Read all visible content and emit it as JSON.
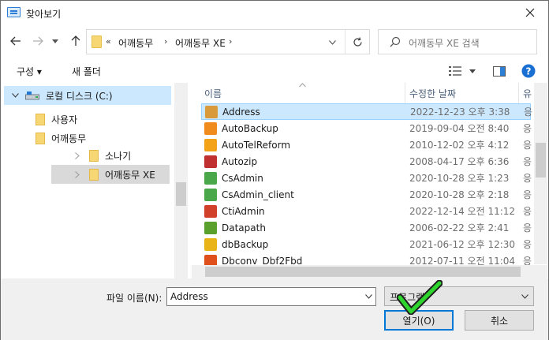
{
  "window": {
    "title": "찾아보기"
  },
  "address": {
    "overflow": "«",
    "crumbs": [
      "어깨동무",
      "어깨동무 XE"
    ]
  },
  "search": {
    "placeholder": "어깨동무 XE 검색"
  },
  "toolbar": {
    "organize": "구성 ▾",
    "new_folder": "새 폴더"
  },
  "tree": [
    {
      "label": "로컬 디스크 (C:)",
      "icon": "drive-icon"
    },
    {
      "label": "사용자",
      "icon": "folder-icon"
    },
    {
      "label": "어깨동무",
      "icon": "folder-icon"
    },
    {
      "label": "소나기",
      "icon": "folder-icon"
    },
    {
      "label": "어깨동무 XE",
      "icon": "folder-icon"
    }
  ],
  "columns": {
    "name": "이름",
    "date": "수정한 날짜",
    "type": "유"
  },
  "files": [
    {
      "name": "Address",
      "date": "2022-12-23 오후 3:38",
      "type": "응",
      "icon": "address-book-icon",
      "color": "#d99a3c"
    },
    {
      "name": "AutoBackup",
      "date": "2019-09-04 오전 8:40",
      "type": "응",
      "icon": "database-icon",
      "color": "#f08c1e"
    },
    {
      "name": "AutoTelReform",
      "date": "2010-12-02 오후 4:12",
      "type": "응",
      "icon": "telephone-icon",
      "color": "#f2a318"
    },
    {
      "name": "Autozip",
      "date": "2008-04-17 오후 6:36",
      "type": "응",
      "icon": "window-app-icon",
      "color": "#c03030"
    },
    {
      "name": "CsAdmin",
      "date": "2020-10-28 오후 1:23",
      "type": "응",
      "icon": "gear-icon",
      "color": "#4aa84a"
    },
    {
      "name": "CsAdmin_client",
      "date": "2020-10-28 오후 2:18",
      "type": "응",
      "icon": "gear-icon",
      "color": "#4aa84a"
    },
    {
      "name": "CtiAdmin",
      "date": "2022-12-14 오전 11:12",
      "type": "응",
      "icon": "phone-icon",
      "color": "#d0402a"
    },
    {
      "name": "Datapath",
      "date": "2006-02-22 오후 2:41",
      "type": "응",
      "icon": "datapath-icon",
      "color": "#5aa02c"
    },
    {
      "name": "dbBackup",
      "date": "2021-06-12 오후 12:30",
      "type": "응",
      "icon": "backup-icon",
      "color": "#e8b417"
    },
    {
      "name": "Dbconv_Dbf2Fbd",
      "date": "2012-07-11 오전 11:04",
      "type": "응",
      "icon": "firebird-icon",
      "color": "#e0501c"
    }
  ],
  "filename": {
    "label": "파일 이름(N):",
    "value": "Address"
  },
  "filetype": {
    "value": "프로그램"
  },
  "buttons": {
    "open": "열기(O)",
    "cancel": "취소"
  }
}
